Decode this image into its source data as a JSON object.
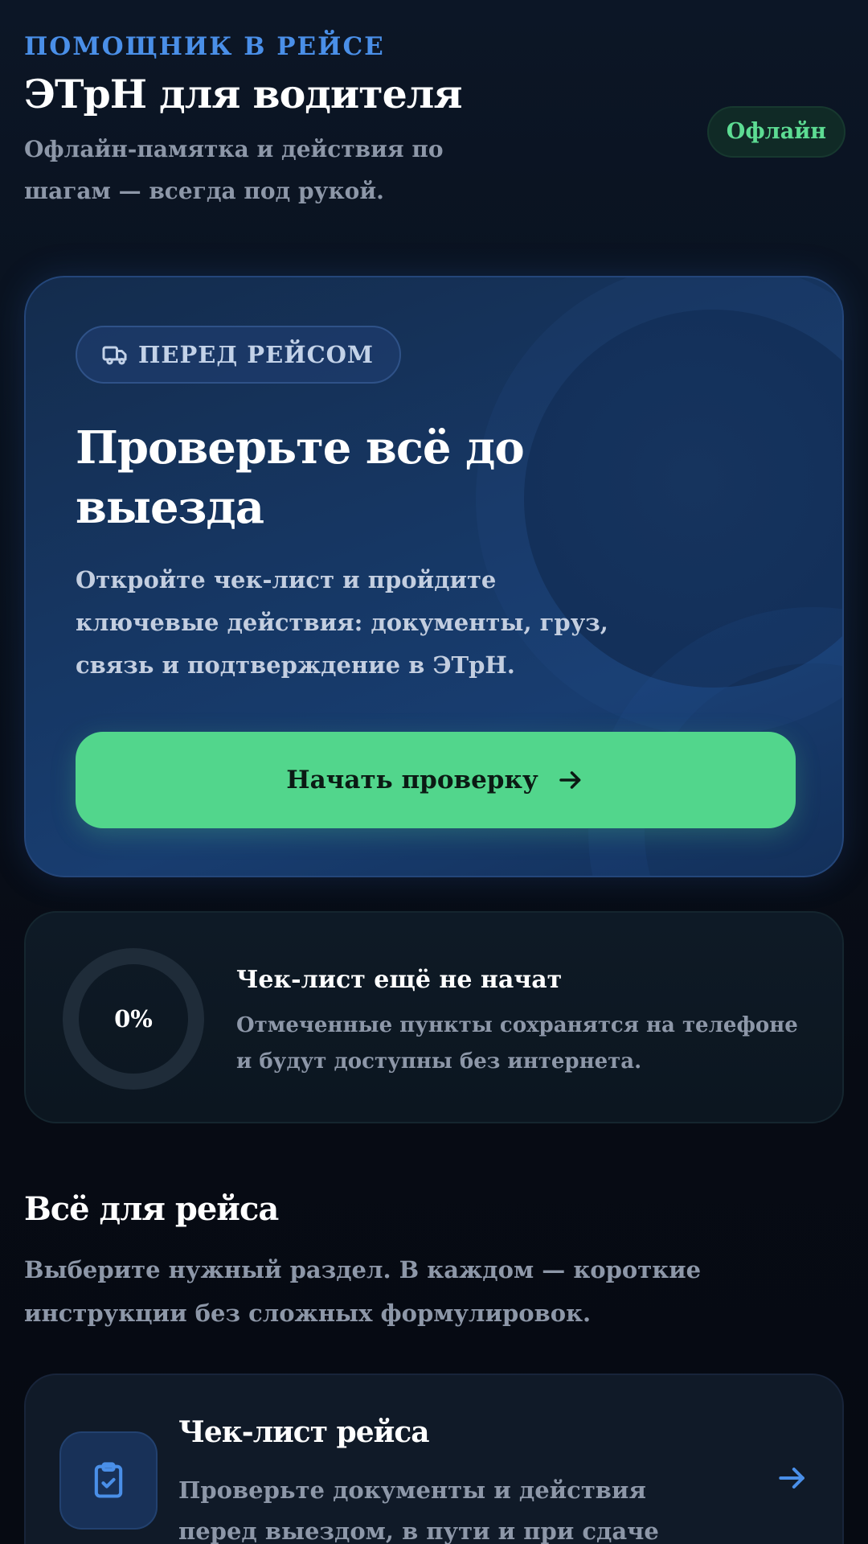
{
  "header": {
    "eyebrow": "ПОМОЩНИК В РЕЙСЕ",
    "title": "ЭТрН для водителя",
    "subtitle": "Офлайн-памятка и действия по шагам — всегда под рукой.",
    "status_badge": "Офлайн"
  },
  "hero": {
    "pill_label": "ПЕРЕД РЕЙСОМ",
    "pill_icon": "truck-icon",
    "title": "Проверьте всё до выезда",
    "text": "Откройте чек-лист и пройдите ключевые действия: документы, груз, связь и подтверждение в ЭТрН.",
    "button_label": "Начать проверку",
    "button_icon": "arrow-right-icon"
  },
  "progress": {
    "percent_label": "0%",
    "value": 0,
    "title": "Чек-лист ещё не начат",
    "text": "Отмеченные пункты сохранятся на телефоне и будут доступны без интернета."
  },
  "section": {
    "title": "Всё для рейса",
    "text": "Выберите нужный раздел. В каждом — короткие инструкции без сложных формулировок."
  },
  "menu": {
    "items": [
      {
        "icon": "clipboard-check-icon",
        "title": "Чек-лист рейса",
        "text": "Проверьте документы и действия перед выездом, в пути и при сдаче груза."
      }
    ]
  },
  "colors": {
    "accent_blue": "#4a8fe8",
    "accent_green": "#52d68c",
    "background": "#070c16"
  }
}
